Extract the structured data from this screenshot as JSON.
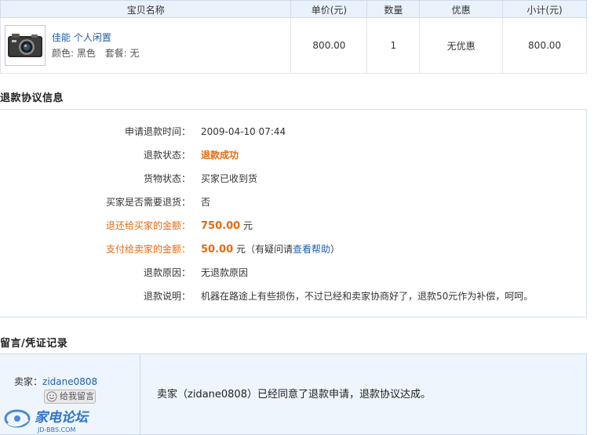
{
  "table": {
    "headers": [
      "宝贝名称",
      "单价(元)",
      "数量",
      "优惠",
      "小计(元)"
    ],
    "item": {
      "title": "佳能 个人闲置",
      "color": "颜色: 黑色",
      "package": "套餐: 无",
      "price": "800.00",
      "qty": "1",
      "discount": "无优惠",
      "subtotal": "800.00"
    }
  },
  "refund": {
    "section_title": "退款协议信息",
    "rows": {
      "apply_time_label": "申请退款时间：",
      "apply_time": "2009-04-10 07:44",
      "status_label": "退款状态：",
      "status": "退款成功",
      "goods_label": "货物状态：",
      "goods": "买家已收到货",
      "return_label": "买家是否需要退货：",
      "return": "否",
      "buyer_amount_label": "退还给买家的金额：",
      "buyer_amount": "750.00",
      "buyer_unit": "元",
      "seller_amount_label": "支付给卖家的金额：",
      "seller_amount": "50.00",
      "seller_unit": "元（有疑问请",
      "help_link": "查看帮助",
      "seller_tail": "）",
      "reason_label": "退款原因：",
      "reason": "无退款原因",
      "desc_label": "退款说明：",
      "desc": "机器在路途上有些损伤，不过已经和卖家协商好了，退款50元作为补偿，呵呵。"
    }
  },
  "messages": {
    "section_title": "留言/凭证记录",
    "seller_prefix": "卖家：",
    "seller_name": "zidane0808",
    "leave_msg_button": "给我留言",
    "message_text": "卖家（zidane0808）已经同意了退款申请，退款协议达成。",
    "watermark_text": "家电论坛",
    "watermark_url": "JD-BBS.COM"
  },
  "colors": {
    "accent_orange": "#e56a10",
    "link_blue": "#1f5fa8",
    "header_bg": "#e9f1fb",
    "message_bg": "#eef5fc"
  }
}
